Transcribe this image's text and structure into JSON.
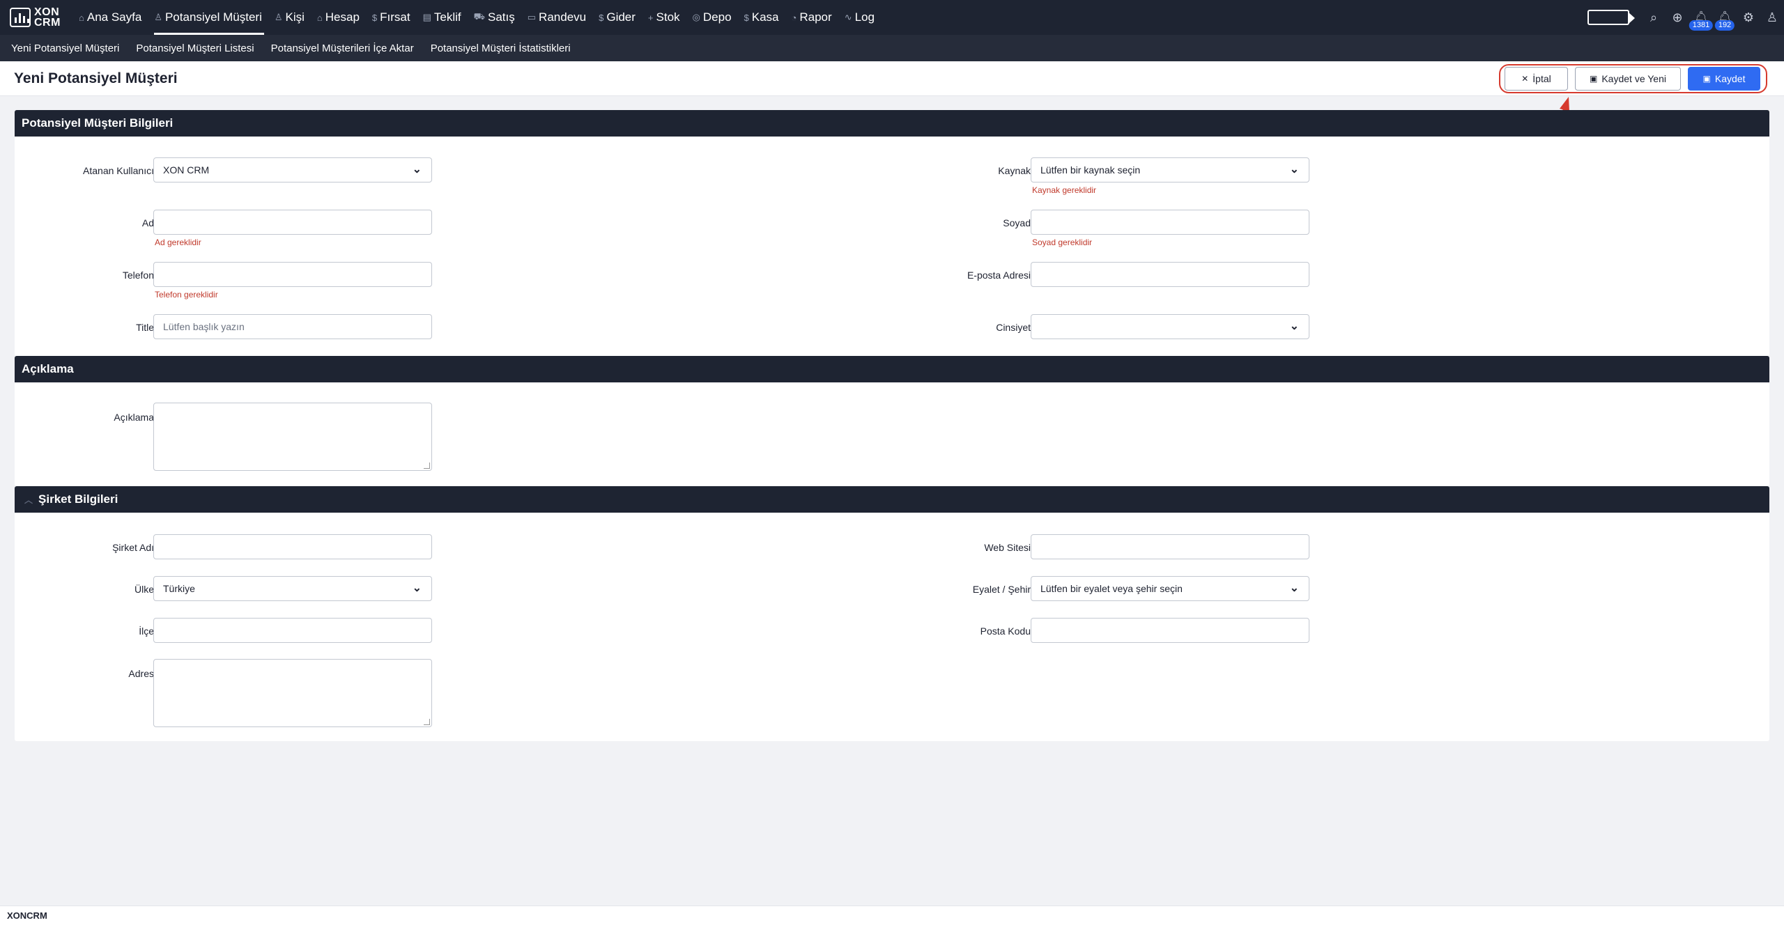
{
  "app": {
    "logo_top": "XON",
    "logo_bottom": "CRM",
    "footer": "XONCRM"
  },
  "nav": [
    {
      "icon": "home-icon",
      "glyph": "⌂",
      "label": "Ana Sayfa"
    },
    {
      "icon": "user-icon",
      "glyph": "♙",
      "label": "Potansiyel Müşteri"
    },
    {
      "icon": "users-icon",
      "glyph": "♙",
      "label": "Kişi"
    },
    {
      "icon": "building-icon",
      "glyph": "⌂",
      "label": "Hesap"
    },
    {
      "icon": "dollar-icon",
      "glyph": "$",
      "label": "Fırsat"
    },
    {
      "icon": "document-icon",
      "glyph": "▤",
      "label": "Teklif"
    },
    {
      "icon": "cart-icon",
      "glyph": "⛟",
      "label": "Satış"
    },
    {
      "icon": "calendar-icon",
      "glyph": "▭",
      "label": "Randevu"
    },
    {
      "icon": "dollar-icon",
      "glyph": "$",
      "label": "Gider"
    },
    {
      "icon": "plus-icon",
      "glyph": "+",
      "label": "Stok"
    },
    {
      "icon": "box-icon",
      "glyph": "◎",
      "label": "Depo"
    },
    {
      "icon": "dollar-icon",
      "glyph": "$",
      "label": "Kasa"
    },
    {
      "icon": "chart-icon",
      "glyph": "◔",
      "label": "Rapor"
    },
    {
      "icon": "activity-icon",
      "glyph": "∿",
      "label": "Log"
    }
  ],
  "notifications": {
    "count_1": "1381",
    "count_2": "192"
  },
  "subnav": [
    "Yeni Potansiyel Müşteri",
    "Potansiyel Müşteri Listesi",
    "Potansiyel Müşterileri İçe Aktar",
    "Potansiyel Müşteri İstatistikleri"
  ],
  "page": {
    "title": "Yeni Potansiyel Müşteri"
  },
  "actions": {
    "cancel": "İptal",
    "save_new": "Kaydet ve Yeni",
    "save": "Kaydet"
  },
  "sections": {
    "lead": {
      "title": "Potansiyel Müşteri Bilgileri",
      "assigned_user_label": "Atanan Kullanıcı",
      "assigned_user_value": "XON CRM",
      "source_label": "Kaynak",
      "source_value": "Lütfen bir kaynak seçin",
      "source_error": "Kaynak gereklidir",
      "first_name_label": "Ad",
      "first_name_error": "Ad gereklidir",
      "last_name_label": "Soyad",
      "last_name_error": "Soyad gereklidir",
      "phone_label": "Telefon",
      "phone_error": "Telefon gereklidir",
      "email_label": "E-posta Adresi",
      "title_label": "Title",
      "title_placeholder": "Lütfen başlık yazın",
      "gender_label": "Cinsiyet"
    },
    "description": {
      "title": "Açıklama",
      "label": "Açıklama"
    },
    "company": {
      "title": "Şirket Bilgileri",
      "company_name_label": "Şirket Adı",
      "website_label": "Web Sitesi",
      "country_label": "Ülke",
      "country_value": "Türkiye",
      "state_label": "Eyalet / Şehir",
      "state_value": "Lütfen bir eyalet veya şehir seçin",
      "district_label": "İlçe",
      "postal_label": "Posta Kodu",
      "address_label": "Adres"
    }
  }
}
